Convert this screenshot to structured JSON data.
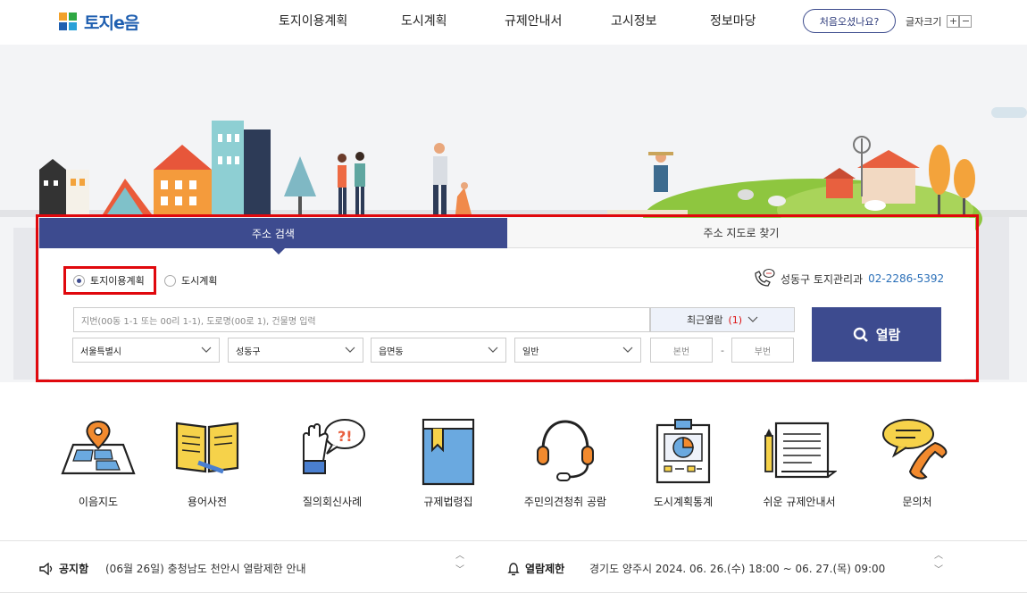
{
  "header": {
    "logo_text": "토지e음",
    "nav": [
      "토지이용계획",
      "도시계획",
      "규제안내서",
      "고시정보",
      "정보마당"
    ],
    "first_visit": "처음오셨나요?",
    "font_size_label": "글자크기",
    "font_plus": "+",
    "font_minus": "−"
  },
  "search": {
    "tabs": [
      "주소 검색",
      "주소 지도로 찾기"
    ],
    "radio_options": [
      "토지이용계획",
      "도시계획"
    ],
    "radio_selected": "토지이용계획",
    "contact_label": "성동구 토지관리과",
    "contact_number": "02-2286-5392",
    "address_placeholder": "지번(00동 1-1 또는 00리 1-1), 도로명(00로 1), 건물명 입력",
    "recent_label": "최근열람",
    "recent_count": "(1)",
    "view_button": "열람",
    "sido": "서울특별시",
    "sigungu": "성동구",
    "dong": "읍면동",
    "type": "일반",
    "main_no": "본번",
    "sub_no": "부번",
    "dash": "-"
  },
  "quick_menu": [
    "이음지도",
    "용어사전",
    "질의회신사례",
    "규제법령집",
    "주민의견청취 공람",
    "도시계획통계",
    "쉬운 규제안내서",
    "문의처"
  ],
  "notices": {
    "notice_label": "공지함",
    "notice_text": "(06월 26일) 충청남도 천안시 열람제한 안내",
    "restrict_label": "열람제한",
    "restrict_text": "경기도 양주시 2024. 06. 26.(수) 18:00 ~ 06. 27.(목) 09:00"
  },
  "colors": {
    "primary": "#3d4b8f",
    "highlight": "#e0080d",
    "link": "#2a6fb8",
    "logo_blue": "#1f5fb0",
    "logo_green": "#2fa843"
  }
}
